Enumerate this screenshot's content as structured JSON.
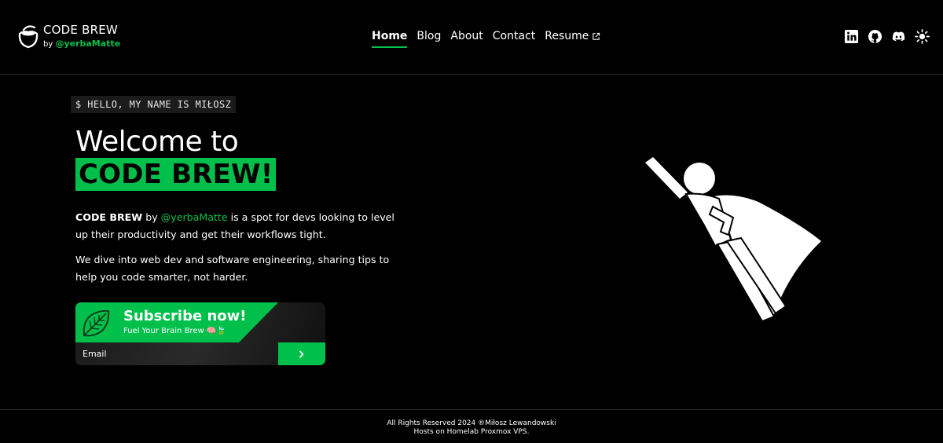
{
  "header": {
    "brand_title": "CODE BREW",
    "brand_by": "by",
    "brand_handle": "@yerbaMatte",
    "nav": [
      {
        "label": "Home",
        "active": true
      },
      {
        "label": "Blog"
      },
      {
        "label": "About"
      },
      {
        "label": "Contact"
      },
      {
        "label": "Resume",
        "external": true
      }
    ],
    "socials": [
      "linkedin-icon",
      "github-icon",
      "discord-icon",
      "theme-toggle-sun-icon"
    ]
  },
  "hero": {
    "tagline": "$ HELLO, MY NAME IS MIŁOSZ",
    "title_line1": "Welcome to",
    "title_line2": "CODE BREW!",
    "p1_brand": "CODE BREW",
    "p1_by": "by",
    "p1_handle": "@yerbaMatte",
    "p1_rest": "is a spot for devs looking to level up their productivity and get their workflows tight.",
    "p2": "We dive into web dev and software engineering, sharing tips to help you code smarter, not harder."
  },
  "subscribe": {
    "title": "Subscribe now!",
    "subtitle": "Fuel Your Brain Brew 🧠🍃",
    "email_placeholder": "Email",
    "submit_icon": "chevron-right-icon"
  },
  "footer": {
    "line1": "All Rights Reserved 2024 ®Miłosz Lewandowski",
    "line2": "Hosts on Homelab Proxmox VPS."
  },
  "colors": {
    "accent": "#00c04b",
    "background": "#000000"
  }
}
